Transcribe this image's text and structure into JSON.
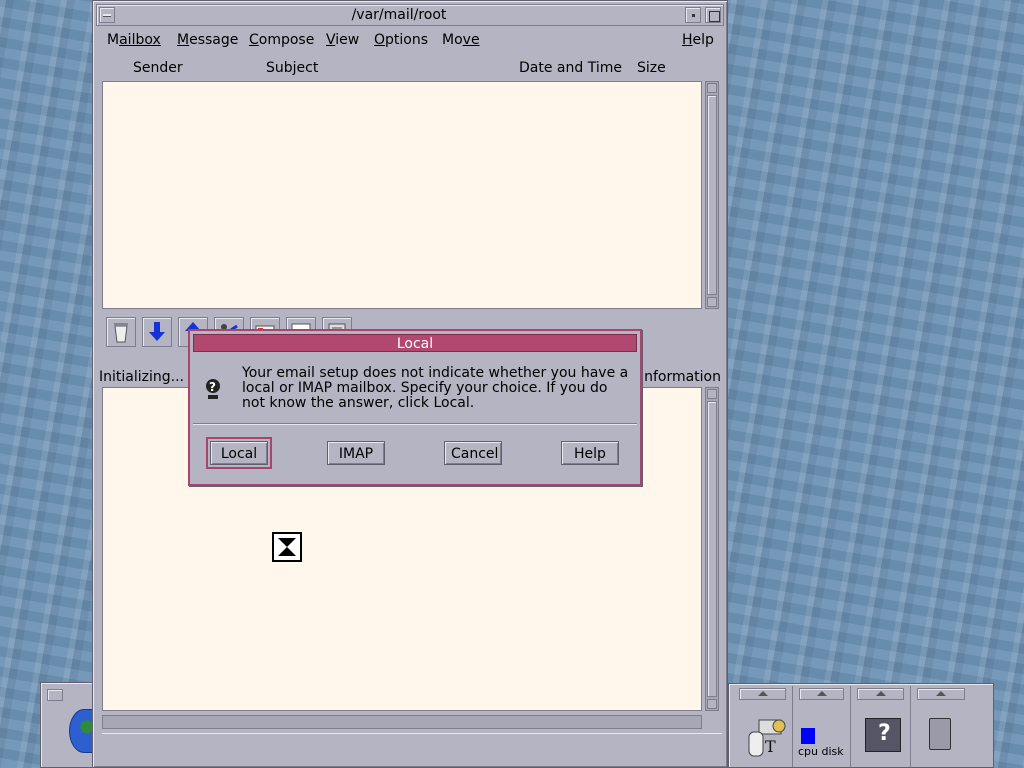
{
  "window": {
    "title": "/var/mail/root"
  },
  "menubar": {
    "items": [
      {
        "pre": "",
        "u": "M",
        "post": "ailbox"
      },
      {
        "pre": "",
        "u": "M",
        "post": "essage"
      },
      {
        "pre": "",
        "u": "C",
        "post": "ompose"
      },
      {
        "pre": "",
        "u": "V",
        "post": "iew"
      },
      {
        "pre": "",
        "u": "O",
        "post": "ptions"
      },
      {
        "pre": "Mo",
        "u": "v",
        "post": "e"
      },
      {
        "pre": "",
        "u": "H",
        "post": "elp"
      }
    ]
  },
  "columns": {
    "sender": "Sender",
    "subject": "Subject",
    "date": "Date and Time",
    "size": "Size"
  },
  "status": {
    "left": "Initializing...",
    "right": "nformation"
  },
  "dialog": {
    "title": "Local",
    "message": "Your email setup does not indicate whether you have a\nlocal or IMAP mailbox.  Specify your choice.  If you do\nnot know the answer, click Local.",
    "buttons": {
      "local": "Local",
      "imap": "IMAP",
      "cancel": "Cancel",
      "help": "Help"
    }
  },
  "front_panel": {
    "cpu_disk_label": "cpu disk"
  },
  "icons": [
    "globe-icon",
    "tools-icon",
    "cpu-meter-icon",
    "help-books-icon",
    "trash-icon",
    "hourglass-icon",
    "question-icon"
  ]
}
